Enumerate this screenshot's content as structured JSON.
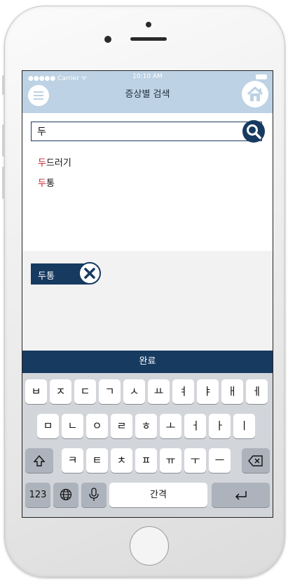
{
  "status": {
    "carrier": "●●●●● Carrier ᯤ",
    "time": "10:10 AM"
  },
  "navbar": {
    "title": "증상별 검색",
    "menu_icon": "hamburger-menu-icon",
    "home_icon": "home-icon"
  },
  "search": {
    "value": "두",
    "icon": "search-icon"
  },
  "suggestions": [
    {
      "hl": "두",
      "rest": "드러기"
    },
    {
      "hl": "두",
      "rest": "통"
    }
  ],
  "tag": {
    "label": "두통",
    "icon": "close-icon"
  },
  "done_bar": {
    "label": "완료"
  },
  "keyboard": {
    "row1": [
      "ㅂ",
      "ㅈ",
      "ㄷ",
      "ㄱ",
      "ㅅ",
      "ㅛ",
      "ㅕ",
      "ㅑ",
      "ㅐ",
      "ㅔ"
    ],
    "row2": [
      "ㅁ",
      "ㄴ",
      "ㅇ",
      "ㄹ",
      "ㅎ",
      "ㅗ",
      "ㅓ",
      "ㅏ",
      "ㅣ"
    ],
    "row3": [
      "ㅋ",
      "ㅌ",
      "ㅊ",
      "ㅍ",
      "ㅠ",
      "ㅜ",
      "ㅡ"
    ],
    "numbers_label": "123",
    "space_label": "간격",
    "shift_icon": "shift-icon",
    "delete_icon": "backspace-icon",
    "globe_icon": "globe-icon",
    "mic_icon": "microphone-icon",
    "return_icon": "return-icon"
  }
}
